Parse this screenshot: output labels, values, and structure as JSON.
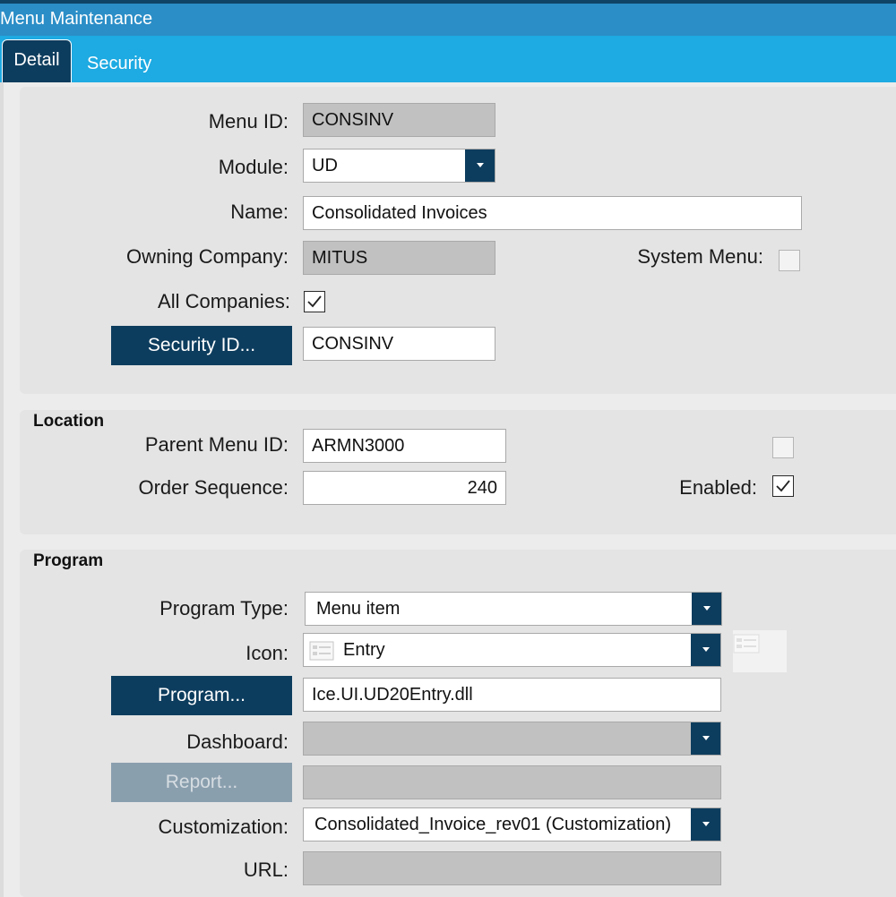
{
  "window": {
    "title": "Menu Maintenance"
  },
  "tabs": [
    {
      "label": "Detail",
      "active": true
    },
    {
      "label": "Security",
      "active": false
    }
  ],
  "general": {
    "menu_id_label": "Menu ID:",
    "menu_id_value": "CONSINV",
    "module_label": "Module:",
    "module_value": "UD",
    "name_label": "Name:",
    "name_value": "Consolidated Invoices",
    "owning_company_label": "Owning Company:",
    "owning_company_value": "MITUS",
    "system_menu_label": "System Menu:",
    "system_menu_checked": false,
    "all_companies_label": "All Companies:",
    "all_companies_checked": true,
    "security_id_button": "Security ID...",
    "security_id_value": "CONSINV"
  },
  "location": {
    "title": "Location",
    "parent_menu_id_label": "Parent Menu ID:",
    "parent_menu_id_value": "ARMN3000",
    "order_sequence_label": "Order Sequence:",
    "order_sequence_value": "240",
    "unlabeled_checkbox_checked": false,
    "enabled_label": "Enabled:",
    "enabled_checked": true
  },
  "program": {
    "title": "Program",
    "program_type_label": "Program Type:",
    "program_type_value": "Menu item",
    "icon_label": "Icon:",
    "icon_value": "Entry",
    "icon_glyph": "entry-icon",
    "program_button": "Program...",
    "program_value": "Ice.UI.UD20Entry.dll",
    "dashboard_label": "Dashboard:",
    "dashboard_value": "",
    "report_button": "Report...",
    "report_value": "",
    "customization_label": "Customization:",
    "customization_value": "Consolidated_Invoice_rev01 (Customization)",
    "url_label": "URL:",
    "url_value": ""
  },
  "colors": {
    "title_bar": "#2b8ec7",
    "tab_bar": "#1eaae2",
    "accent_button": "#0d3d5e",
    "readonly_field": "#c1c1c1",
    "panel": "#e4e4e4"
  }
}
